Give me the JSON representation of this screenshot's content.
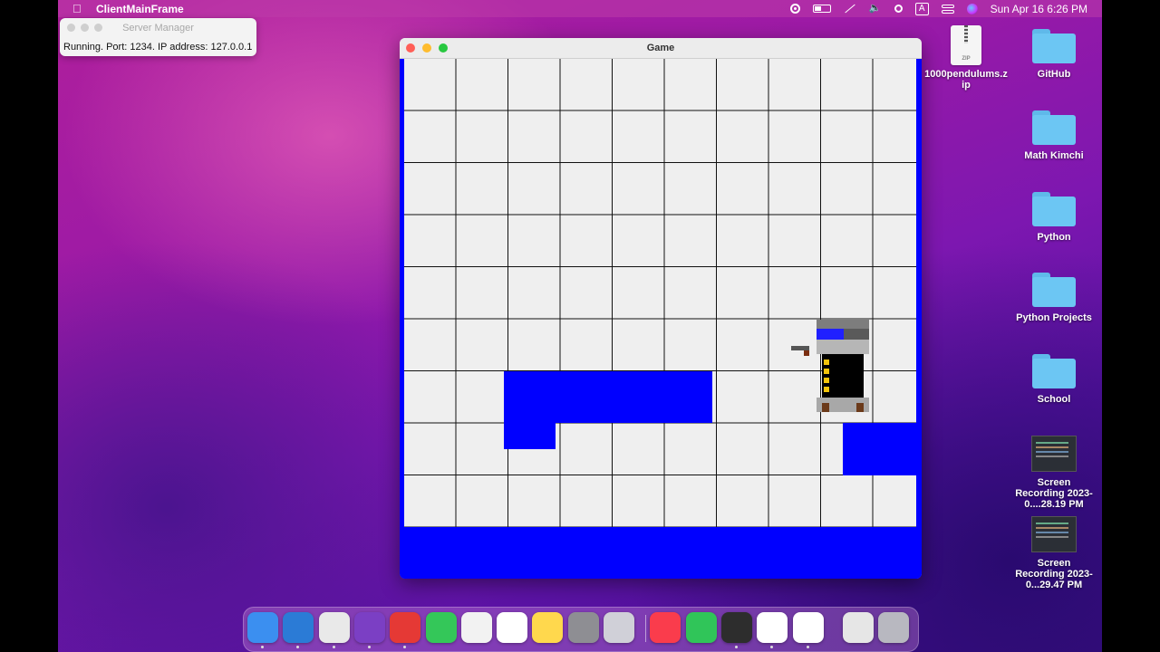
{
  "menubar": {
    "app_name": "ClientMainFrame",
    "clock": "Sun Apr 16  6:26 PM",
    "input_source": "A",
    "status_icons": [
      "screen-record-icon",
      "battery-icon",
      "wifi-off-icon",
      "volume-icon",
      "spotlight-search-icon",
      "input-source-icon",
      "control-center-icon",
      "siri-icon"
    ]
  },
  "server_manager": {
    "title": "Server Manager",
    "status": "Running. Port: 1234. IP address: 127.0.0.1"
  },
  "game_window": {
    "title": "Game",
    "grid": {
      "columns": 10,
      "rows": 9
    },
    "colors": {
      "wall": "#0000ff",
      "cell": "#efefef",
      "grid_line": "#111111"
    }
  },
  "desktop": {
    "items": [
      {
        "label": "1000pendulums.zip",
        "kind": "zip",
        "badge": "ZIP"
      },
      {
        "label": "GitHub",
        "kind": "folder"
      },
      {
        "label": "Math Kimchi",
        "kind": "folder"
      },
      {
        "label": "Python",
        "kind": "folder"
      },
      {
        "label": "Python Projects",
        "kind": "folder"
      },
      {
        "label": "School",
        "kind": "folder"
      },
      {
        "label": "Screen Recording 2023-0....28.19 PM",
        "kind": "video"
      },
      {
        "label": "Screen Recording 2023-0...29.47 PM",
        "kind": "video"
      }
    ]
  },
  "dock": {
    "apps": [
      {
        "name": "finder-icon",
        "color": "#3b8ff0",
        "running": true
      },
      {
        "name": "vscode-icon",
        "color": "#2b7bd6",
        "running": true
      },
      {
        "name": "chrome-icon",
        "color": "#e9e9e9",
        "running": true
      },
      {
        "name": "github-desktop-icon",
        "color": "#7b3fc4",
        "running": true
      },
      {
        "name": "screen-recorder-icon",
        "color": "#e53935",
        "running": true
      },
      {
        "name": "messages-icon",
        "color": "#34c759",
        "running": false
      },
      {
        "name": "chatgpt-icon",
        "color": "#f2f2f2",
        "running": false
      },
      {
        "name": "reminders-icon",
        "color": "#ffffff",
        "running": false
      },
      {
        "name": "notes-icon",
        "color": "#ffd84d",
        "running": false
      },
      {
        "name": "system-settings-icon",
        "color": "#8e8e93",
        "running": false
      },
      {
        "name": "launchpad-icon",
        "color": "#d0d0d8",
        "running": false
      },
      {
        "name": "music-icon",
        "color": "#fa3c4c",
        "running": false
      },
      {
        "name": "facetime-icon",
        "color": "#30c559",
        "running": false
      },
      {
        "name": "quicktime-icon",
        "color": "#2d2d2d",
        "running": true
      },
      {
        "name": "java-app-icon",
        "color": "#ffffff",
        "running": true
      },
      {
        "name": "java-app-icon",
        "color": "#ffffff",
        "running": true
      },
      {
        "name": "document-icon",
        "color": "#e6e6e6",
        "running": false
      },
      {
        "name": "trash-icon",
        "color": "#b8b8c0",
        "running": false
      }
    ]
  }
}
